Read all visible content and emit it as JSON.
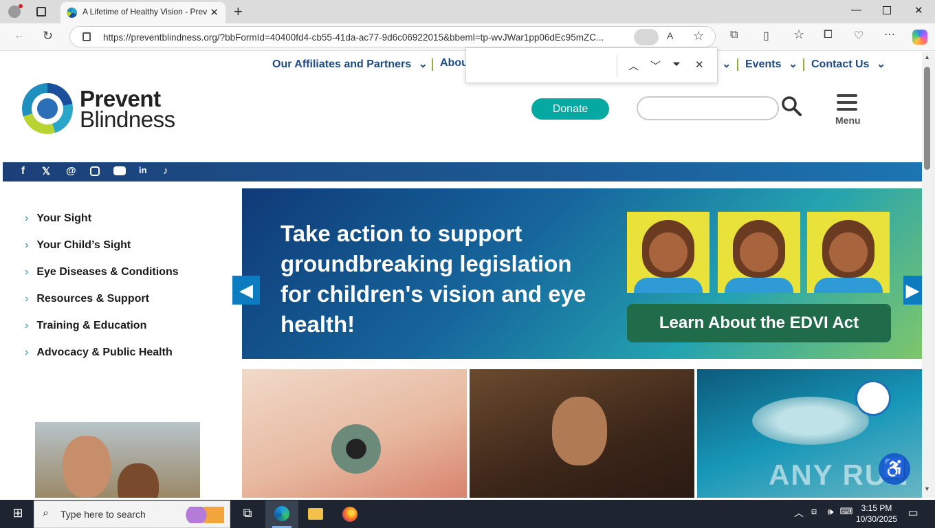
{
  "browser": {
    "tab_title": "A Lifetime of Healthy Vision - Prev",
    "url": "https://preventblindness.org/?bbFormId=40400fd4-cb55-41da-ac77-9d6c06922015&bbeml=tp-wvJWar1pp06dEc95mZC..."
  },
  "topnav": {
    "affiliates": "Our Affiliates and Partners",
    "about": "Abou",
    "events": "Events",
    "contact": "Contact Us"
  },
  "logo": {
    "line1": "Prevent",
    "line2": "Blindness"
  },
  "header": {
    "donate": "Donate",
    "menu": "Menu"
  },
  "sidenav": {
    "items": [
      {
        "label": "Your Sight"
      },
      {
        "label": "Your Child’s Sight"
      },
      {
        "label": "Eye Diseases & Conditions"
      },
      {
        "label": "Resources & Support"
      },
      {
        "label": "Training & Education"
      },
      {
        "label": "Advocacy & Public Health"
      }
    ]
  },
  "banner": {
    "headline": "Take action to support groundbreaking legislation for children's vision and eye health!",
    "cta": "Learn About the EDVI Act"
  },
  "watermark": "ANY RUN",
  "taskbar": {
    "search_placeholder": "Type here to search",
    "time": "3:15 PM",
    "date": "10/30/2025"
  },
  "colors": {
    "brand_blue": "#1d4b86",
    "donate_teal": "#05a9a1",
    "accent_green": "#8db33c"
  }
}
